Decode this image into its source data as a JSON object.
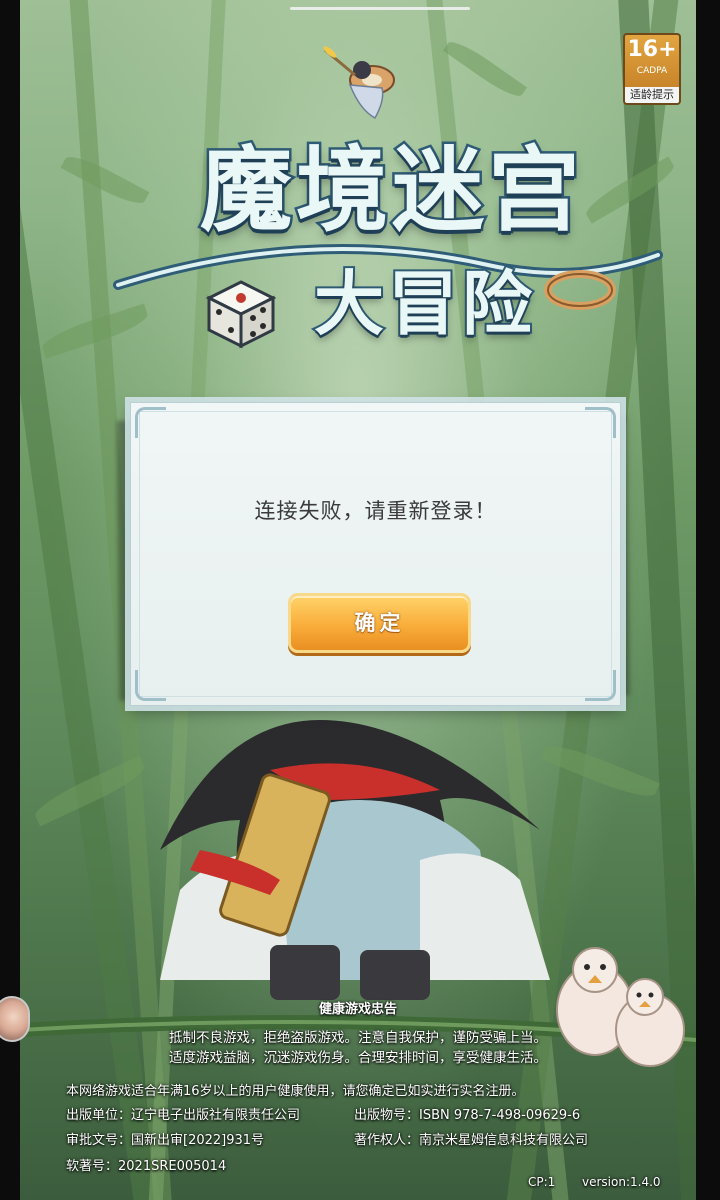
{
  "age_rating": {
    "number": "16+",
    "org": "CADPA",
    "label": "适龄提示"
  },
  "logo": {
    "line1": "魔境迷宫",
    "line2": "大冒险"
  },
  "dialog": {
    "message": "连接失败，请重新登录！",
    "confirm_label": "确定"
  },
  "health_notice": {
    "title": "健康游戏忠告",
    "line1": "抵制不良游戏，拒绝盗版游戏。注意自我保护，谨防受骗上当。",
    "line2": "适度游戏益脑，沉迷游戏伤身。合理安排时间，享受健康生活。"
  },
  "info": {
    "notice": "本网络游戏适合年满16岁以上的用户健康使用，请您确定已如实进行实名注册。",
    "publisher": "出版单位：辽宁电子出版社有限责任公司",
    "pubnum": "出版物号：ISBN 978-7-498-09629-6",
    "approval": "审批文号：国新出审[2022]931号",
    "copyright": "著作权人：南京米星姆信息科技有限公司",
    "softreg": "软著号：2021SRE005014",
    "cp": "CP:1",
    "version": "version:1.4.0"
  },
  "icons": {
    "dice": "dice-icon",
    "birds": "birds-icon",
    "avatar": "avatar-icon"
  },
  "colors": {
    "button_gradient_top": "#ffd36a",
    "button_gradient_bottom": "#e98f22",
    "logo_outline": "#2f5d77",
    "dialog_bg": "#f1f6f6"
  }
}
